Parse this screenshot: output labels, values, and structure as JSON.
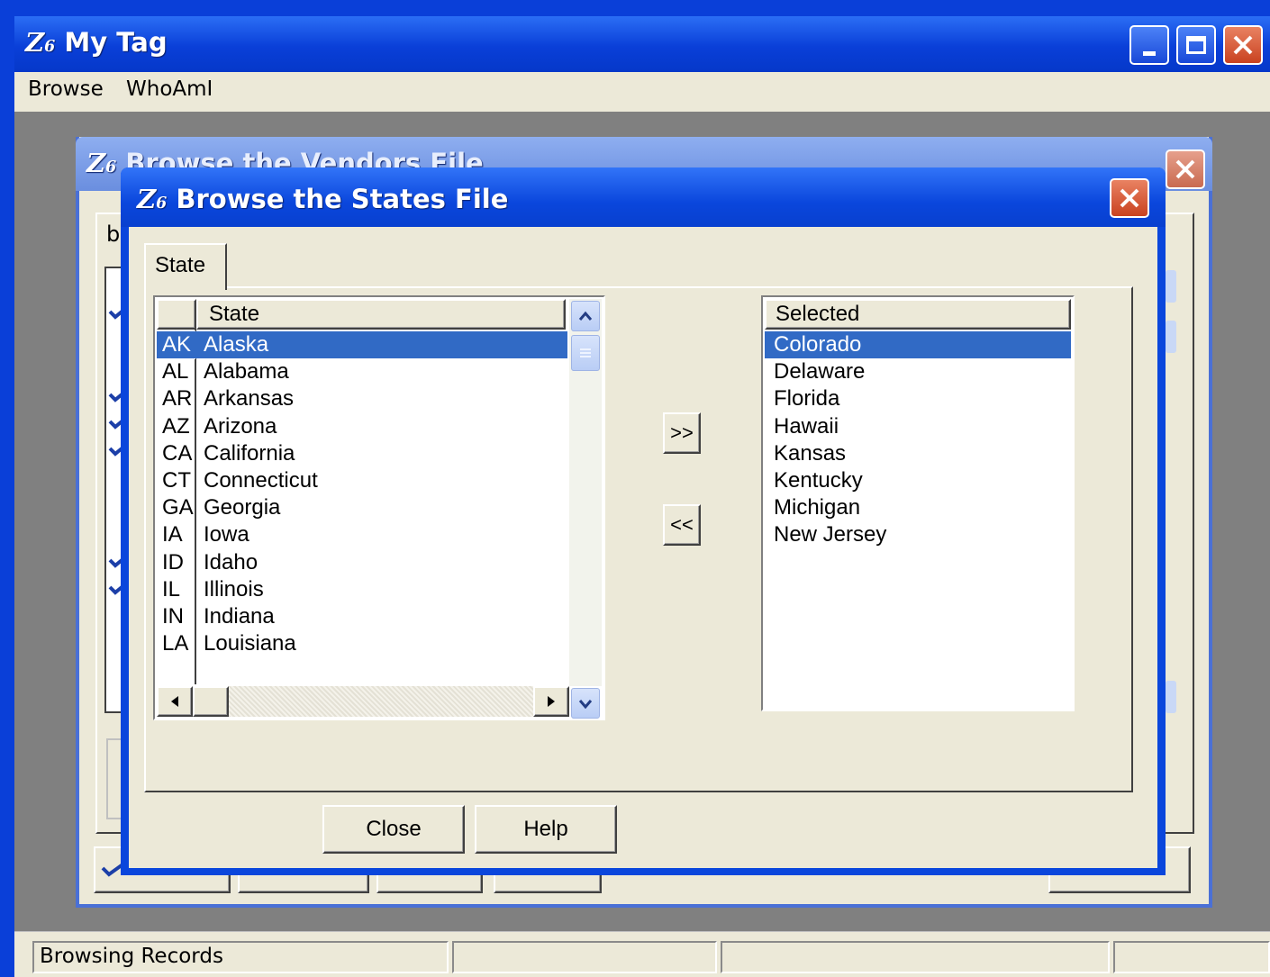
{
  "app": {
    "title": "My Tag",
    "icon": "Z6-app-icon",
    "menu": [
      "Browse",
      "WhoAmI"
    ]
  },
  "background_dialog": {
    "title": "Browse the Vendors File",
    "tab_fragment": "b"
  },
  "dialog": {
    "title": "Browse the States File",
    "tab": "State",
    "available": {
      "header_code": "",
      "header_name": "State",
      "rows": [
        {
          "code": "AK",
          "name": "Alaska"
        },
        {
          "code": "AL",
          "name": "Alabama"
        },
        {
          "code": "AR",
          "name": "Arkansas"
        },
        {
          "code": "AZ",
          "name": "Arizona"
        },
        {
          "code": "CA",
          "name": "California"
        },
        {
          "code": "CT",
          "name": "Connecticut"
        },
        {
          "code": "GA",
          "name": "Georgia"
        },
        {
          "code": "IA",
          "name": "Iowa"
        },
        {
          "code": "ID",
          "name": "Idaho"
        },
        {
          "code": "IL",
          "name": "Illinois"
        },
        {
          "code": "IN",
          "name": "Indiana"
        },
        {
          "code": "LA",
          "name": "Louisiana"
        }
      ],
      "selected_index": 0
    },
    "add_label": ">>",
    "remove_label": "<<",
    "selected": {
      "header": "Selected",
      "rows": [
        "Colorado",
        "Delaware",
        "Florida",
        "Hawaii",
        "Kansas",
        "Kentucky",
        "Michigan",
        "New Jersey"
      ],
      "selected_index": 0
    },
    "close_label": "Close",
    "help_label": "Help"
  },
  "status": {
    "panels": [
      "Browsing Records",
      "",
      "",
      ""
    ]
  },
  "colors": {
    "title_blue": "#0a46dc",
    "selection": "#316ac5",
    "close_red": "#d9532c",
    "face": "#ece9d8"
  }
}
